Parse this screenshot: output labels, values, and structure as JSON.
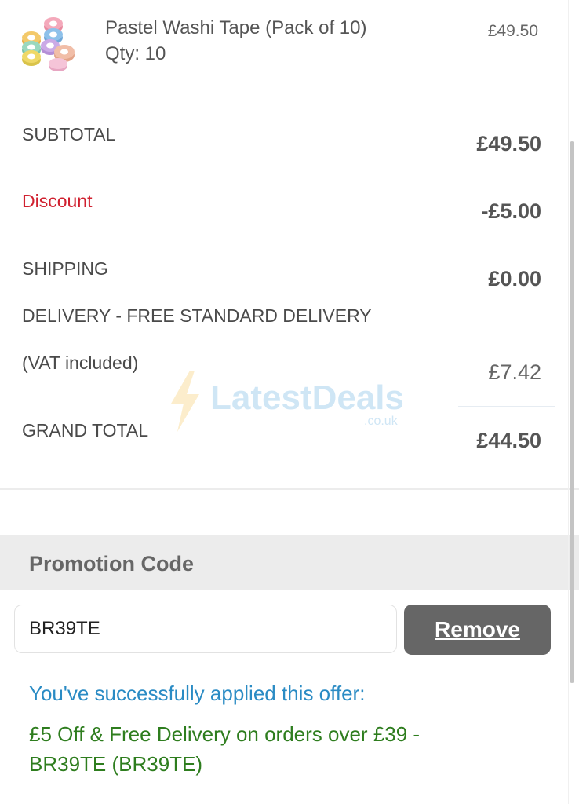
{
  "product": {
    "name": "Pastel Washi Tape (Pack of 10)",
    "qty": "Qty: 10",
    "price": "£49.50",
    "thumbnail_icon": "washi-tape-rolls-icon"
  },
  "summary": {
    "subtotal_label": "SUBTOTAL",
    "subtotal_value": "£49.50",
    "discount_label": "Discount",
    "discount_value": "-£5.00",
    "shipping_label": "SHIPPING",
    "shipping_value": "£0.00",
    "delivery_label": "DELIVERY - FREE STANDARD DELIVERY",
    "vat_label": "(VAT included)",
    "vat_value": "£7.42",
    "grand_total_label": "GRAND TOTAL",
    "grand_total_value": "£44.50"
  },
  "watermark": {
    "brand": "LatestDeals",
    "domain": ".co.uk"
  },
  "promo": {
    "title": "Promotion Code",
    "code_value": "BR39TE",
    "remove_label": "Remove",
    "success_message": "You've successfully applied this offer:",
    "offer_description": "£5 Off & Free Delivery on orders over £39 - BR39TE (BR39TE)"
  },
  "colors": {
    "discount": "#d0202f",
    "success": "#2a8bc4",
    "offer": "#2e7d1e",
    "button": "#666666"
  }
}
